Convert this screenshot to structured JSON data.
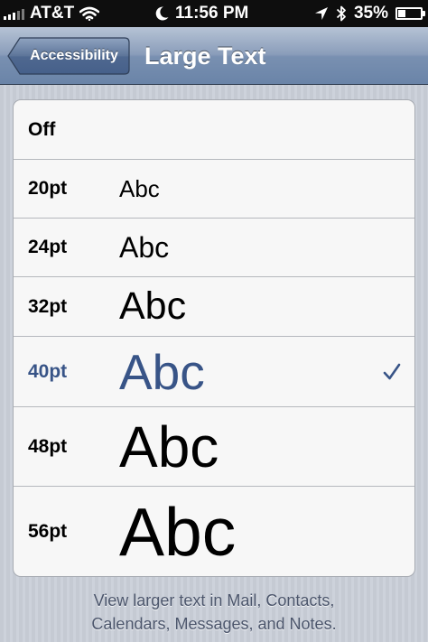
{
  "status_bar": {
    "carrier": "AT&T",
    "time": "11:56 PM",
    "battery_percent": "35%",
    "battery_level": 0.35,
    "icons": [
      "signal-bars-icon",
      "wifi-icon",
      "moon-icon",
      "location-arrow-icon",
      "bluetooth-icon",
      "battery-icon"
    ]
  },
  "nav": {
    "back_label": "Accessibility",
    "title": "Large Text"
  },
  "sizes": [
    {
      "label": "Off",
      "sample": ""
    },
    {
      "label": "20pt",
      "sample": "Abc"
    },
    {
      "label": "24pt",
      "sample": "Abc"
    },
    {
      "label": "32pt",
      "sample": "Abc"
    },
    {
      "label": "40pt",
      "sample": "Abc",
      "selected": true
    },
    {
      "label": "48pt",
      "sample": "Abc"
    },
    {
      "label": "56pt",
      "sample": "Abc"
    }
  ],
  "footer": {
    "line1": "View larger text in Mail, Contacts,",
    "line2": "Calendars, Messages, and Notes."
  },
  "colors": {
    "selected_text": "#385487",
    "nav_bar": "#7990b1",
    "status_bar": "#0e0e0e"
  }
}
